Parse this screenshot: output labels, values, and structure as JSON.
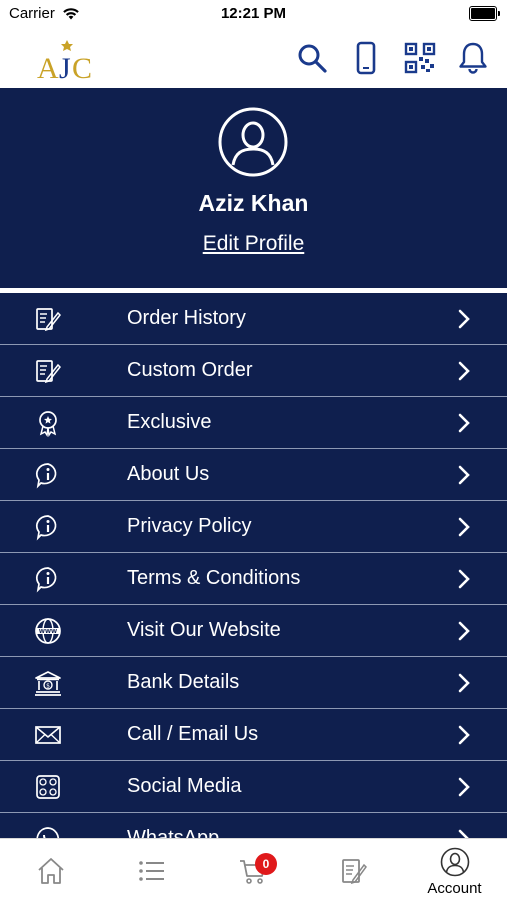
{
  "status_bar": {
    "carrier": "Carrier",
    "time": "12:21 PM"
  },
  "header": {
    "logo_text": "AJC",
    "icons": [
      "search-icon",
      "phone-icon",
      "qr-code-icon",
      "bell-icon"
    ]
  },
  "profile": {
    "name": "Aziz Khan",
    "edit_label": "Edit Profile"
  },
  "menu": {
    "items": [
      {
        "label": "Order History",
        "icon": "order-history-icon"
      },
      {
        "label": "Custom Order",
        "icon": "custom-order-icon"
      },
      {
        "label": "Exclusive",
        "icon": "badge-icon"
      },
      {
        "label": "About Us",
        "icon": "info-icon"
      },
      {
        "label": "Privacy Policy",
        "icon": "info-icon"
      },
      {
        "label": "Terms & Conditions",
        "icon": "info-icon"
      },
      {
        "label": "Visit Our Website",
        "icon": "globe-icon"
      },
      {
        "label": "Bank Details",
        "icon": "bank-icon"
      },
      {
        "label": "Call / Email Us",
        "icon": "mail-icon"
      },
      {
        "label": "Social Media",
        "icon": "social-icon"
      },
      {
        "label": "WhatsApp",
        "icon": "whatsapp-icon"
      }
    ]
  },
  "tabbar": {
    "cart_badge": "0",
    "account_label": "Account",
    "tabs": [
      "home-icon",
      "list-icon",
      "cart-icon",
      "orders-icon",
      "account-icon"
    ]
  },
  "colors": {
    "navy": "#0f1f4e",
    "gold": "#c9a227",
    "badge_red": "#e0191b",
    "header_icon_blue": "#1a3a8c"
  }
}
